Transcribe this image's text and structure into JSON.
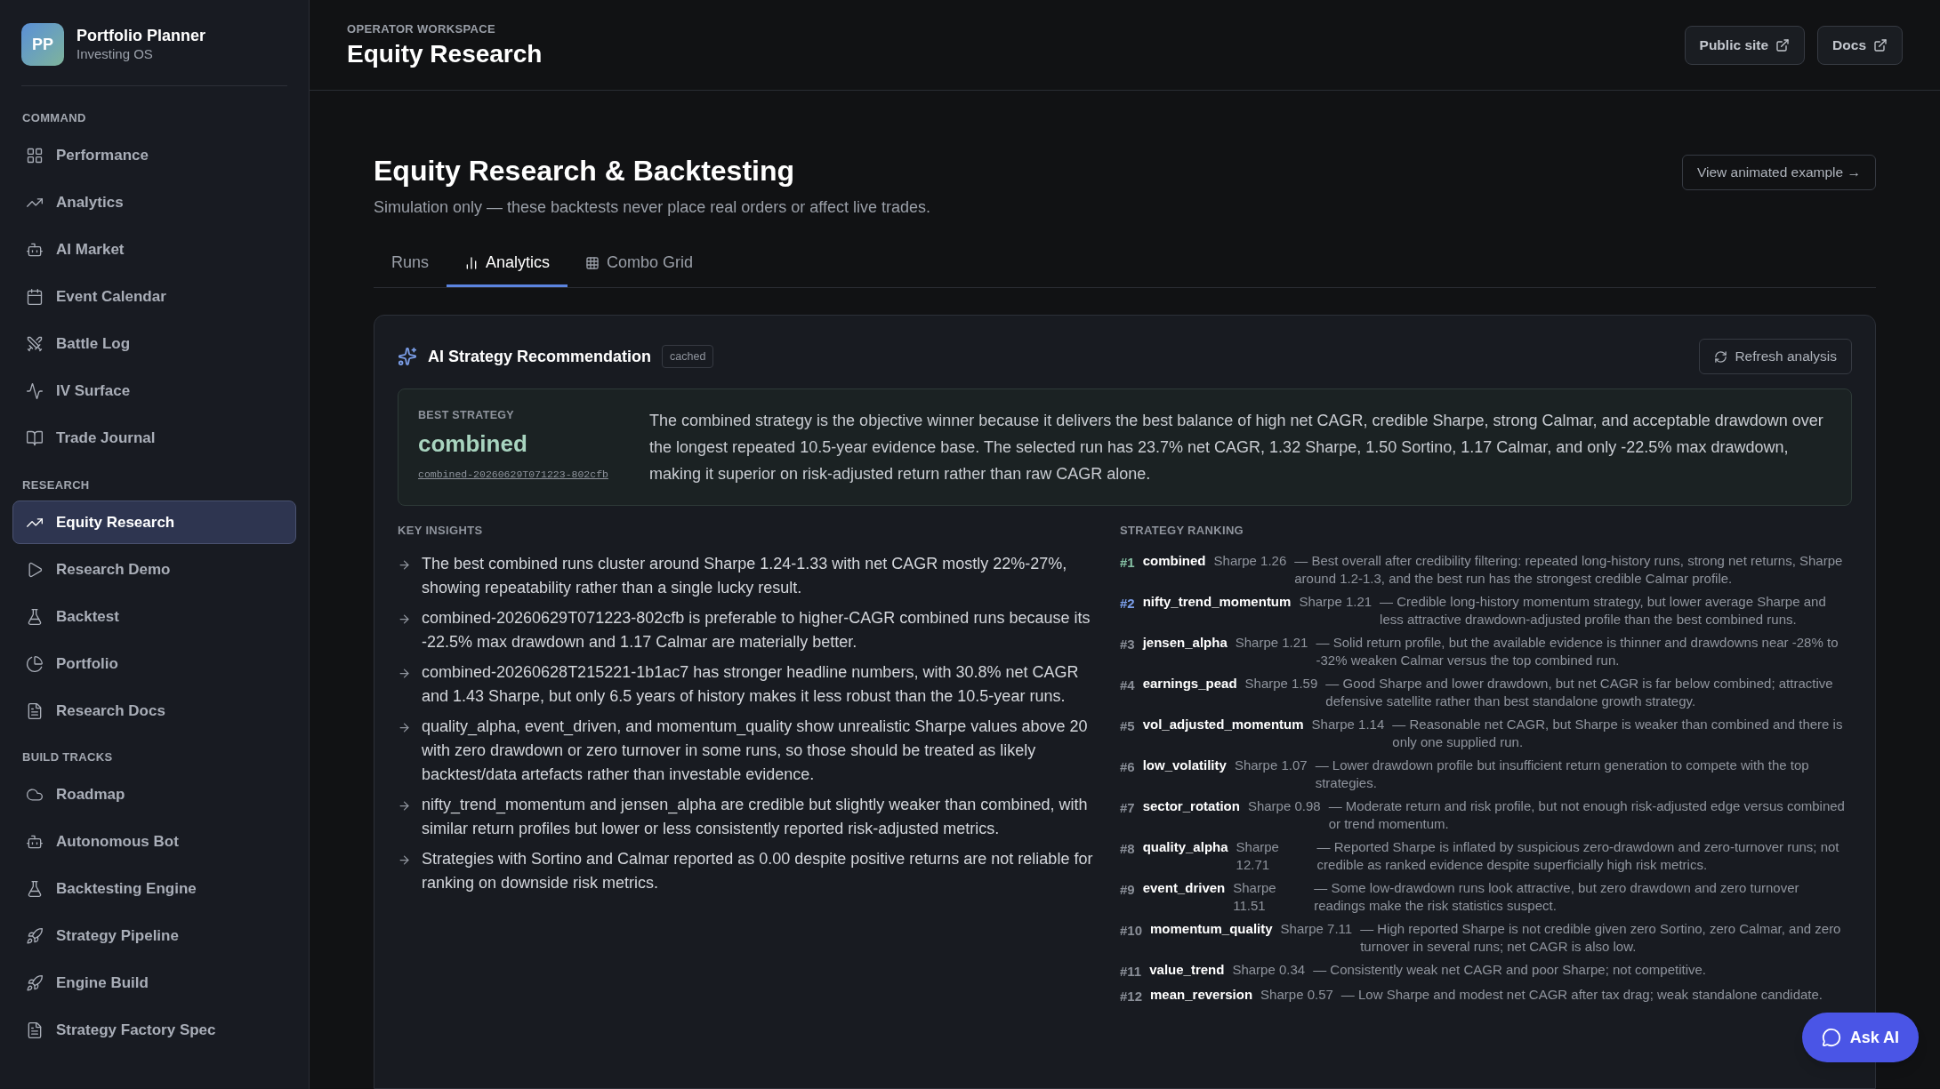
{
  "brand": {
    "initials": "PP",
    "name": "Portfolio Planner",
    "subtitle": "Investing OS"
  },
  "sidebar": {
    "sections": [
      {
        "title": "COMMAND",
        "items": [
          {
            "label": "Performance",
            "selected": false
          },
          {
            "label": "Analytics",
            "selected": false
          },
          {
            "label": "AI Market",
            "selected": false
          },
          {
            "label": "Event Calendar",
            "selected": false
          },
          {
            "label": "Battle Log",
            "selected": false
          },
          {
            "label": "IV Surface",
            "selected": false
          },
          {
            "label": "Trade Journal",
            "selected": false
          }
        ]
      },
      {
        "title": "RESEARCH",
        "items": [
          {
            "label": "Equity Research",
            "selected": true
          },
          {
            "label": "Research Demo",
            "selected": false
          },
          {
            "label": "Backtest",
            "selected": false
          },
          {
            "label": "Portfolio",
            "selected": false
          },
          {
            "label": "Research Docs",
            "selected": false
          }
        ]
      },
      {
        "title": "BUILD TRACKS",
        "items": [
          {
            "label": "Roadmap",
            "selected": false
          },
          {
            "label": "Autonomous Bot",
            "selected": false
          },
          {
            "label": "Backtesting Engine",
            "selected": false
          },
          {
            "label": "Strategy Pipeline",
            "selected": false
          },
          {
            "label": "Engine Build",
            "selected": false
          },
          {
            "label": "Strategy Factory Spec",
            "selected": false
          }
        ]
      }
    ]
  },
  "header": {
    "eyebrow": "OPERATOR WORKSPACE",
    "title": "Equity Research",
    "links": [
      "Public site",
      "Docs"
    ]
  },
  "page": {
    "title": "Equity Research & Backtesting",
    "subtitle": "Simulation only — these backtests never place real orders or affect live trades.",
    "example_link": "View animated example →"
  },
  "tabs": [
    {
      "label": "Runs",
      "selected": false
    },
    {
      "label": "Analytics",
      "selected": true
    },
    {
      "label": "Combo Grid",
      "selected": false
    }
  ],
  "recommendation": {
    "title": "AI Strategy Recommendation",
    "badge": "cached",
    "refresh": "Refresh analysis",
    "best_label": "BEST STRATEGY",
    "best_name": "combined",
    "best_run": "combined-20260629T071223-802cfb",
    "summary": "The combined strategy is the objective winner because it delivers the best balance of high net CAGR, credible Sharpe, strong Calmar, and acceptable drawdown over the longest repeated 10.5-year evidence base. The selected run has 23.7% net CAGR, 1.32 Sharpe, 1.50 Sortino, 1.17 Calmar, and only -22.5% max drawdown, making it superior on risk-adjusted return rather than raw CAGR alone."
  },
  "insights": {
    "title": "KEY INSIGHTS",
    "items": [
      "The best combined runs cluster around Sharpe 1.24-1.33 with net CAGR mostly 22%-27%, showing repeatability rather than a single lucky result.",
      "combined-20260629T071223-802cfb is preferable to higher-CAGR combined runs because its -22.5% max drawdown and 1.17 Calmar are materially better.",
      "combined-20260628T215221-1b1ac7 has stronger headline numbers, with 30.8% net CAGR and 1.43 Sharpe, but only 6.5 years of history makes it less robust than the 10.5-year runs.",
      "quality_alpha, event_driven, and momentum_quality show unrealistic Sharpe values above 20 with zero drawdown or zero turnover in some runs, so those should be treated as likely backtest/data artefacts rather than investable evidence.",
      "nifty_trend_momentum and jensen_alpha are credible but slightly weaker than combined, with similar return profiles but lower or less consistently reported risk-adjusted metrics.",
      "Strategies with Sortino and Calmar reported as 0.00 despite positive returns are not reliable for ranking on downside risk metrics."
    ]
  },
  "ranking": {
    "title": "STRATEGY RANKING",
    "items": [
      {
        "rank": "#1",
        "color": "#86c0a4",
        "name": "combined",
        "sharpe": "Sharpe 1.26",
        "note": "— Best overall after credibility filtering: repeated long-history runs, strong net returns, Sharpe around 1.2-1.3, and the best run has the strongest credible Calmar profile."
      },
      {
        "rank": "#2",
        "color": "#7b9ee8",
        "name": "nifty_trend_momentum",
        "sharpe": "Sharpe 1.21",
        "note": "— Credible long-history momentum strategy, but lower average Sharpe and less attractive drawdown-adjusted profile than the best combined runs."
      },
      {
        "rank": "#3",
        "color": "#8a8f98",
        "name": "jensen_alpha",
        "sharpe": "Sharpe 1.21",
        "note": "— Solid return profile, but the available evidence is thinner and drawdowns near -28% to -32% weaken Calmar versus the top combined run."
      },
      {
        "rank": "#4",
        "color": "#8a8f98",
        "name": "earnings_pead",
        "sharpe": "Sharpe 1.59",
        "note": "— Good Sharpe and lower drawdown, but net CAGR is far below combined; attractive defensive satellite rather than best standalone growth strategy."
      },
      {
        "rank": "#5",
        "color": "#8a8f98",
        "name": "vol_adjusted_momentum",
        "sharpe": "Sharpe 1.14",
        "note": "— Reasonable net CAGR, but Sharpe is weaker than combined and there is only one supplied run."
      },
      {
        "rank": "#6",
        "color": "#8a8f98",
        "name": "low_volatility",
        "sharpe": "Sharpe 1.07",
        "note": "— Lower drawdown profile but insufficient return generation to compete with the top strategies."
      },
      {
        "rank": "#7",
        "color": "#8a8f98",
        "name": "sector_rotation",
        "sharpe": "Sharpe 0.98",
        "note": "— Moderate return and risk profile, but not enough risk-adjusted edge versus combined or trend momentum."
      },
      {
        "rank": "#8",
        "color": "#8a8f98",
        "name": "quality_alpha",
        "sharpe": "Sharpe 12.71",
        "note": "— Reported Sharpe is inflated by suspicious zero-drawdown and zero-turnover runs; not credible as ranked evidence despite superficially high risk metrics."
      },
      {
        "rank": "#9",
        "color": "#8a8f98",
        "name": "event_driven",
        "sharpe": "Sharpe 11.51",
        "note": "— Some low-drawdown runs look attractive, but zero drawdown and zero turnover readings make the risk statistics suspect."
      },
      {
        "rank": "#10",
        "color": "#8a8f98",
        "name": "momentum_quality",
        "sharpe": "Sharpe 7.11",
        "note": "— High reported Sharpe is not credible given zero Sortino, zero Calmar, and zero turnover in several runs; net CAGR is also low."
      },
      {
        "rank": "#11",
        "color": "#8a8f98",
        "name": "value_trend",
        "sharpe": "Sharpe 0.34",
        "note": "— Consistently weak net CAGR and poor Sharpe; not competitive."
      },
      {
        "rank": "#12",
        "color": "#8a8f98",
        "name": "mean_reversion",
        "sharpe": "Sharpe 0.57",
        "note": "— Low Sharpe and modest net CAGR after tax drag; weak standalone candidate."
      }
    ]
  },
  "assistant_button": "Ask AI"
}
